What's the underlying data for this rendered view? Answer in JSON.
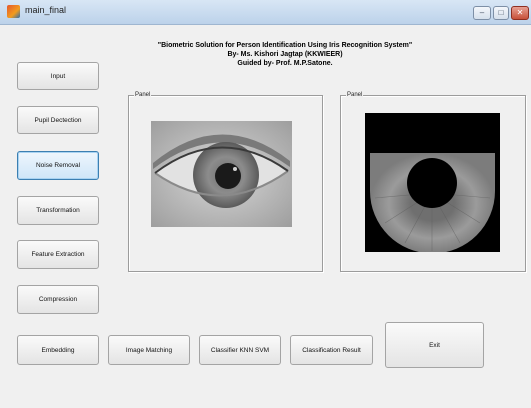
{
  "window": {
    "title": "main_final",
    "minimize_glyph": "–",
    "maximize_glyph": "□",
    "close_glyph": "✕"
  },
  "heading": {
    "line1": "\"Biometric Solution for Person Identification Using Iris Recognition System\"",
    "line2": "By- Ms. Kishori Jagtap (KKWIEER)",
    "line3": "Guided by- Prof. M.P.Satone."
  },
  "buttons": {
    "input": "Input",
    "pupil_detection": "Pupil Dectection",
    "noise_removal": "Noise Removal",
    "transformation": "Transformation",
    "feature_extraction": "Feature Extraction",
    "compression": "Compression",
    "embedding": "Embedding",
    "image_matching": "Image Matching",
    "classifier": "Classifier KNN SVM",
    "classification_result": "Classification Result",
    "exit": "Exit"
  },
  "active_button": "noise_removal",
  "panels": {
    "left_title": "Panel",
    "right_title": "Panel"
  },
  "colors": {
    "window_bg": "#f0f0f0",
    "active_border": "#3c7fb1"
  }
}
